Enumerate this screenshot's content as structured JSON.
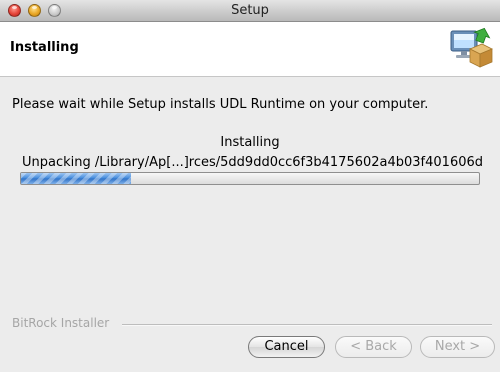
{
  "window": {
    "title": "Setup"
  },
  "header": {
    "title": "Installing",
    "icon": "installer-box-computer-icon"
  },
  "content": {
    "description": "Please wait while Setup installs UDL Runtime on your computer.",
    "status": "Installing",
    "detail": "Unpacking /Library/Ap[...]rces/5dd9dd0cc6f3b4175602a4b03f401606d",
    "progress_fraction": 0.24
  },
  "footer": {
    "brand": "BitRock Installer",
    "buttons": {
      "cancel": "Cancel",
      "back": "< Back",
      "next": "Next >"
    }
  },
  "colors": {
    "progress_fill": "#3e87da",
    "close_button": "#e5453a",
    "minimize_button": "#e9a726",
    "zoom_button": "#c8c8c8"
  }
}
